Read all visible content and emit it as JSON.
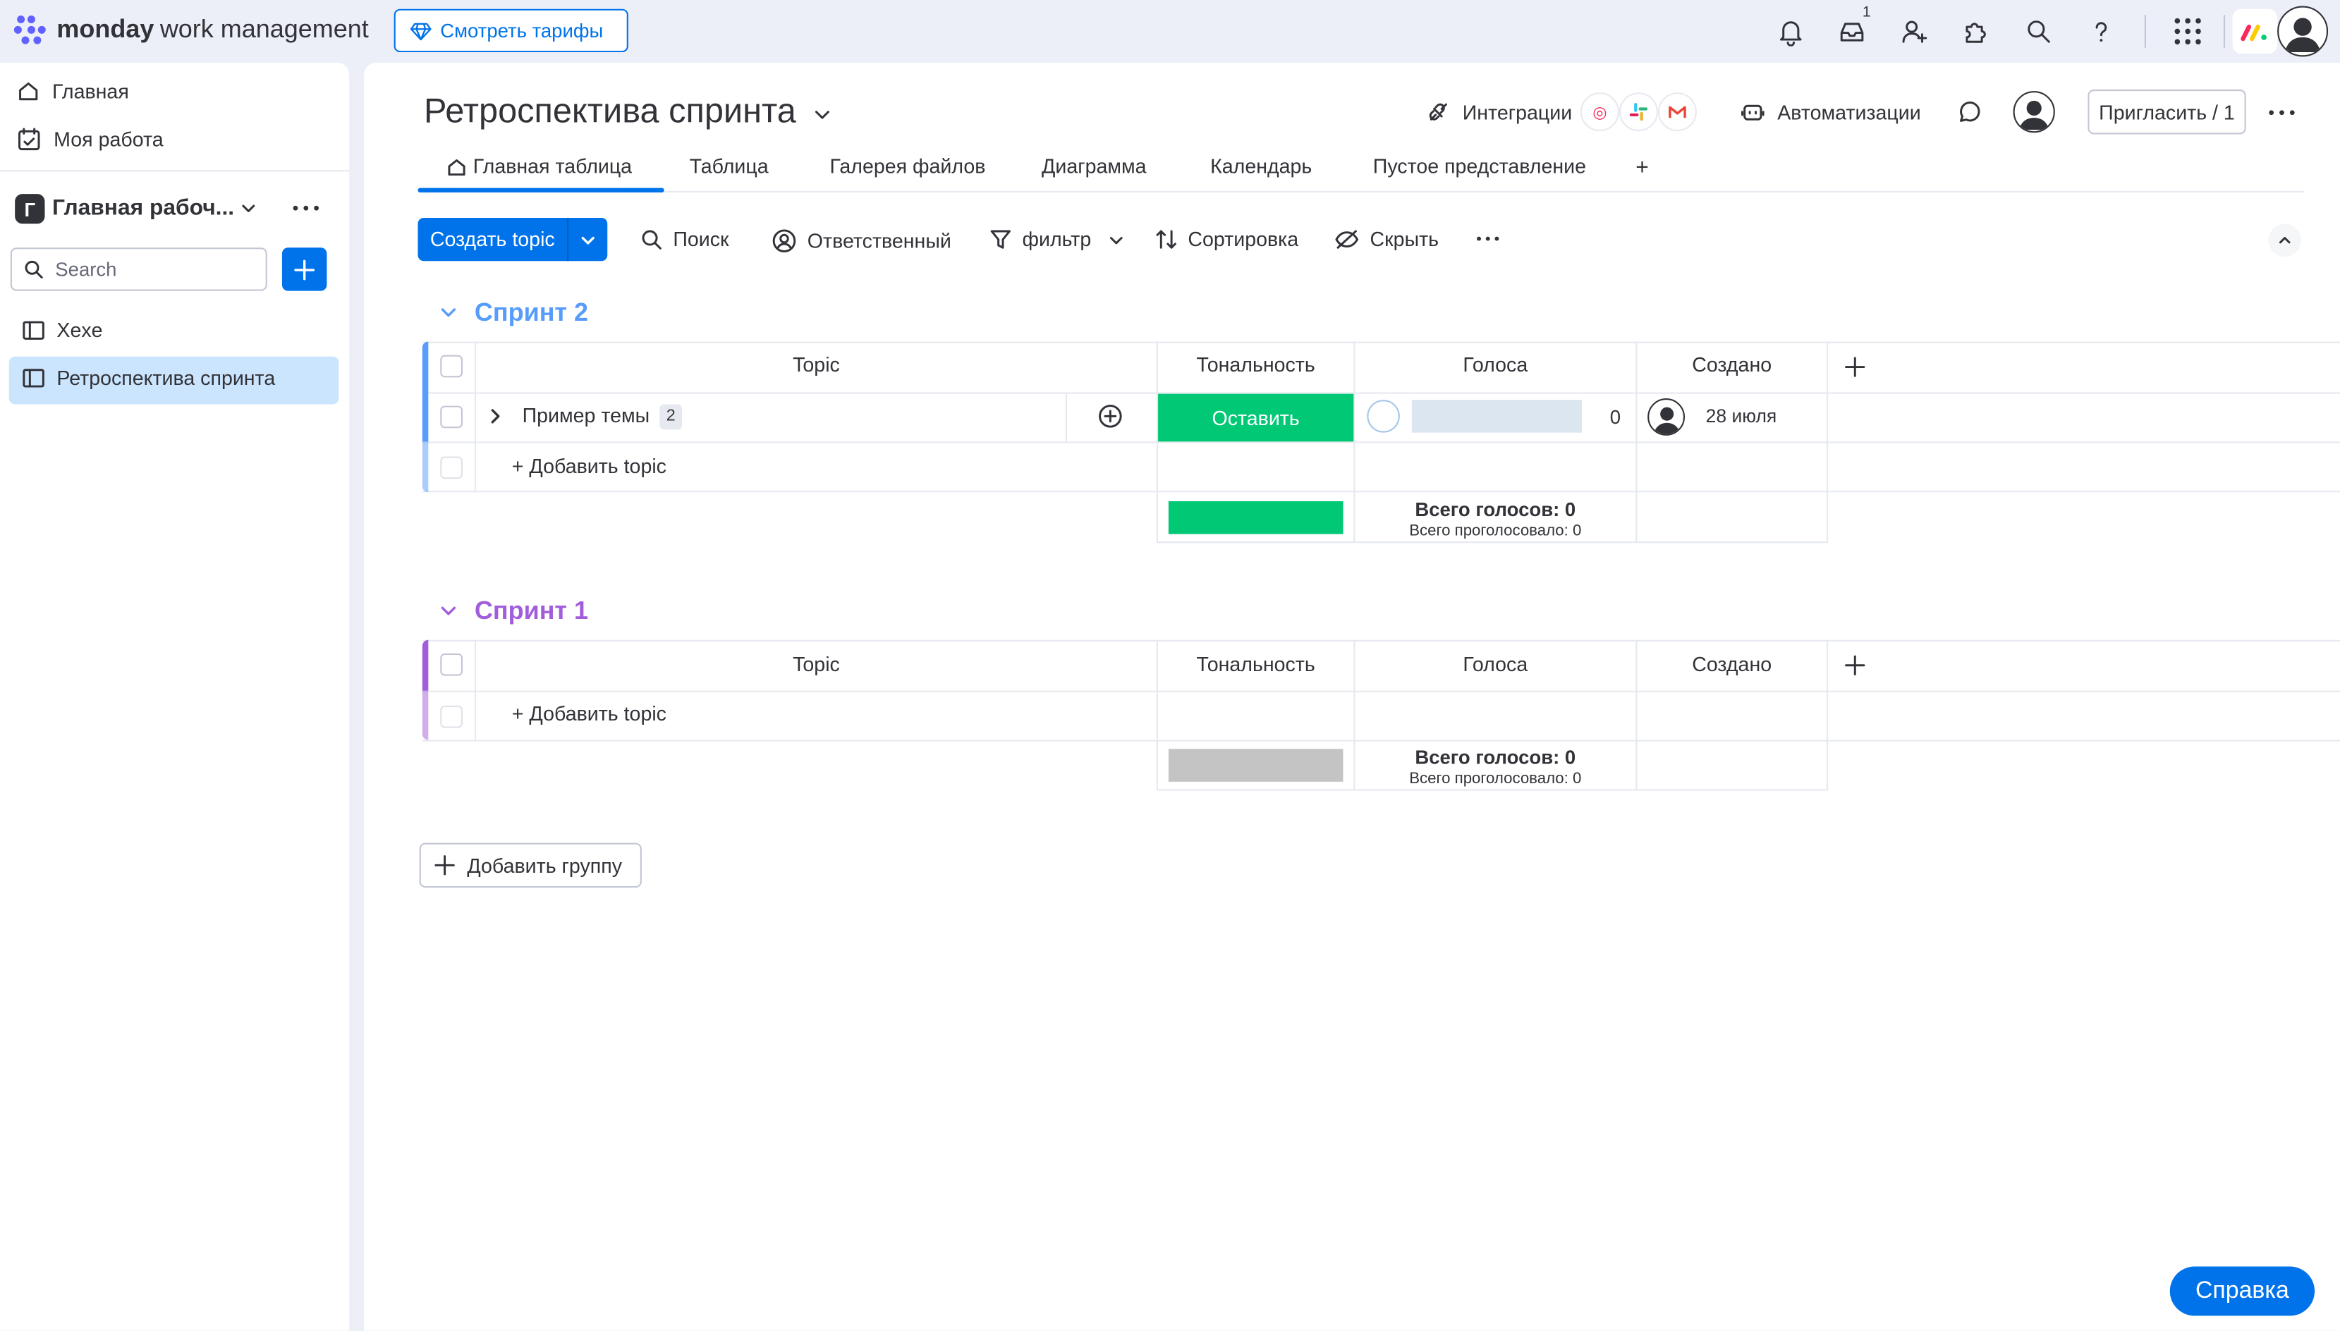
{
  "brand": {
    "bold": "monday",
    "rest": "work management"
  },
  "topbar": {
    "plans_label": "Смотреть тарифы",
    "inbox_count": "1"
  },
  "sidebar": {
    "nav": [
      {
        "label": "Главная"
      },
      {
        "label": "Моя работа"
      }
    ],
    "workspace": {
      "logo_letter": "Г",
      "name": "Главная рабоч..."
    },
    "search_placeholder": "Search",
    "boards": [
      {
        "label": "Xexe"
      },
      {
        "label": "Ретроспектива спринта"
      }
    ]
  },
  "board": {
    "title": "Ретроспектива спринта",
    "integrations_label": "Интеграции",
    "automations_label": "Автоматизации",
    "invite_label": "Пригласить / 1",
    "tabs": [
      {
        "label": "Главная таблица",
        "active": true
      },
      {
        "label": "Таблица"
      },
      {
        "label": "Галерея файлов"
      },
      {
        "label": "Диаграмма"
      },
      {
        "label": "Календарь"
      },
      {
        "label": "Пустое представление"
      },
      {
        "label": "+"
      }
    ],
    "toolbar": {
      "create_label": "Создать topic",
      "search_label": "Поиск",
      "person_label": "Ответственный",
      "filter_label": "фильтр",
      "sort_label": "Сортировка",
      "hide_label": "Скрыть"
    }
  },
  "columns": {
    "topic": "Topic",
    "tone": "Тональность",
    "votes": "Голоса",
    "created": "Создано"
  },
  "groups": [
    {
      "name": "Спринт 2",
      "color": "#579bfc",
      "items": [
        {
          "name": "Пример темы",
          "subitems": "2",
          "tone": "Оставить",
          "tone_color": "#00c875",
          "votes": "0",
          "created": "28 июля"
        }
      ],
      "add_label": "+ Добавить topic",
      "summary_color": "#00c875",
      "summary_votes": "Всего голосов: 0",
      "summary_voted": "Всего проголосовало: 0"
    },
    {
      "name": "Спринт 1",
      "color": "#a25ddc",
      "items": [],
      "add_label": "+ Добавить topic",
      "summary_color": "#c4c4c4",
      "summary_votes": "Всего голосов: 0",
      "summary_voted": "Всего проголосовало: 0"
    }
  ],
  "add_group_label": "Добавить группу",
  "help_label": "Справка"
}
